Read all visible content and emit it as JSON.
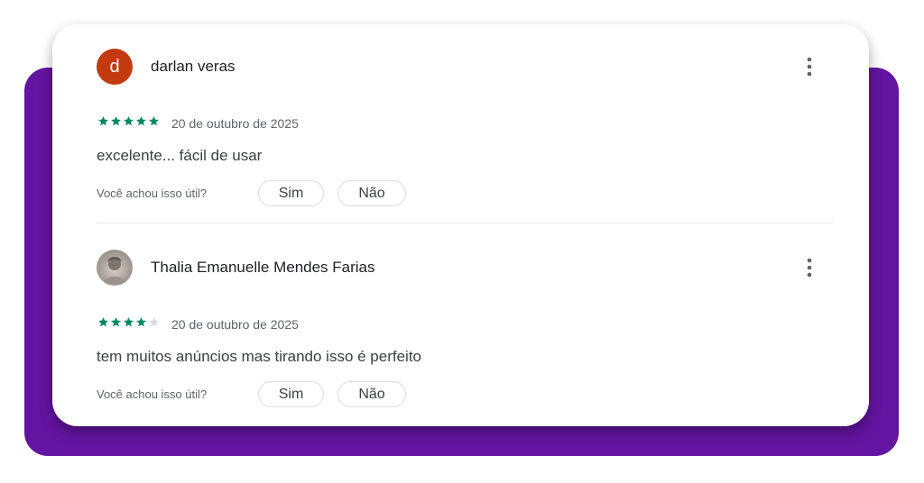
{
  "theme": {
    "accent_background": "#6314a0",
    "star_color": "#01875f",
    "star_empty_color": "#dadce0",
    "avatar_letter_bg": "#c23b0e"
  },
  "helpful": {
    "question": "Você achou isso útil?",
    "yes_label": "Sim",
    "no_label": "Não"
  },
  "reviews": [
    {
      "author": "darlan veras",
      "avatar_letter": "d",
      "rating": 5,
      "max_rating": 5,
      "date": "20 de outubro de 2025",
      "text": "excelente... fácil de usar"
    },
    {
      "author": "Thalia Emanuelle Mendes Farias",
      "avatar_letter": "",
      "rating": 4,
      "max_rating": 5,
      "date": "20 de outubro de 2025",
      "text": "tem muitos anúncios mas tirando isso é perfeito"
    }
  ]
}
